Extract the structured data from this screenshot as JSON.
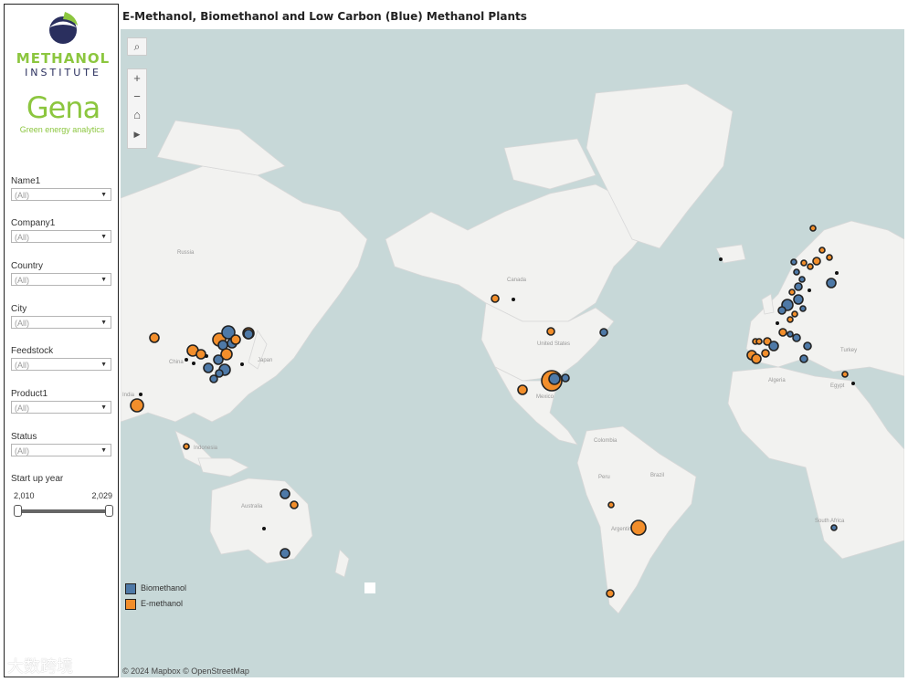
{
  "title": "E-Methanol, Biomethanol and Low Carbon (Blue) Methanol Plants",
  "logos": {
    "methanol_line1": "METHANOL",
    "methanol_line2": "INSTITUTE",
    "gena_name": "Gena",
    "gena_tagline": "Green energy analytics"
  },
  "filters": [
    {
      "label": "Name1",
      "value": "(All)"
    },
    {
      "label": "Company1",
      "value": "(All)"
    },
    {
      "label": "Country",
      "value": "(All)"
    },
    {
      "label": "City",
      "value": "(All)"
    },
    {
      "label": "Feedstock",
      "value": "(All)"
    },
    {
      "label": "Product1",
      "value": "(All)"
    },
    {
      "label": "Status",
      "value": "(All)"
    }
  ],
  "start_year": {
    "label": "Start up year",
    "min": "2,010",
    "max": "2,029"
  },
  "legend": [
    {
      "label": "Biomethanol",
      "color": "#4e79a7"
    },
    {
      "label": "E-methanol",
      "color": "#f28e2b"
    }
  ],
  "map_labels": {
    "russia": "Russia",
    "china": "China",
    "india": "India",
    "japan": "Japan",
    "australia": "Australia",
    "canada": "Canada",
    "united_states": "United States",
    "mexico": "Mexico",
    "colombia": "Colombia",
    "brazil": "Brazil",
    "peru": "Peru",
    "argentina": "Argentina",
    "algeria": "Algeria",
    "egypt": "Egypt",
    "turkey": "Turkey",
    "south_africa": "South Africa",
    "indonesia": "Indonesia"
  },
  "attribution": "© 2024 Mapbox  © OpenStreetMap",
  "watermark": "大数跨境",
  "icons": {
    "search": "search-icon",
    "zoom_in": "plus-icon",
    "zoom_out": "minus-icon",
    "home": "home-icon",
    "play": "play-icon"
  }
}
